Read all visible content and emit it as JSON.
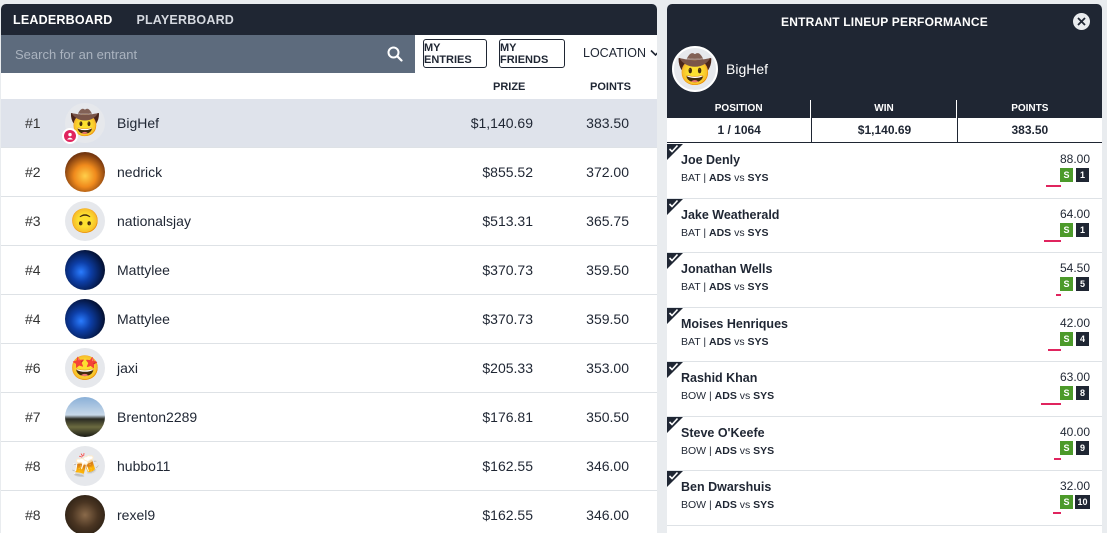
{
  "left": {
    "tabs": [
      "LEADERBOARD",
      "PLAYERBOARD"
    ],
    "search_placeholder": "Search for an entrant",
    "buttons": {
      "my_entries": "MY ENTRIES",
      "my_friends": "MY FRIENDS",
      "location": "LOCATION"
    },
    "columns": {
      "prize": "PRIZE",
      "points": "POINTS"
    },
    "rows": [
      {
        "rank": "#1",
        "name": "BigHef",
        "prize": "$1,140.69",
        "points": "383.50",
        "avatar": "cowboy-emoji",
        "highlight": true
      },
      {
        "rank": "#2",
        "name": "nedrick",
        "prize": "$855.52",
        "points": "372.00",
        "avatar": "fire-photo"
      },
      {
        "rank": "#3",
        "name": "nationalsjay",
        "prize": "$513.31",
        "points": "365.75",
        "avatar": "upside-down-emoji"
      },
      {
        "rank": "#4",
        "name": "Mattylee",
        "prize": "$370.73",
        "points": "359.50",
        "avatar": "blue-lights-photo"
      },
      {
        "rank": "#4",
        "name": "Mattylee",
        "prize": "$370.73",
        "points": "359.50",
        "avatar": "blue-lights-photo"
      },
      {
        "rank": "#6",
        "name": "jaxi",
        "prize": "$205.33",
        "points": "353.00",
        "avatar": "star-struck-emoji"
      },
      {
        "rank": "#7",
        "name": "Brenton2289",
        "prize": "$176.81",
        "points": "350.50",
        "avatar": "car-photo"
      },
      {
        "rank": "#8",
        "name": "hubbo11",
        "prize": "$162.55",
        "points": "346.00",
        "avatar": "beer-emoji"
      },
      {
        "rank": "#8",
        "name": "rexel9",
        "prize": "$162.55",
        "points": "346.00",
        "avatar": "dinosaur-photo"
      }
    ]
  },
  "right": {
    "title": "ENTRANT LINEUP PERFORMANCE",
    "user": "BigHef",
    "stats": [
      {
        "label": "POSITION",
        "value": "1 / 1064"
      },
      {
        "label": "WIN",
        "value": "$1,140.69"
      },
      {
        "label": "POINTS",
        "value": "383.50"
      }
    ],
    "players": [
      {
        "name": "Joe Denly",
        "pos": "BAT",
        "team": "ADS",
        "opp": "SYS",
        "points": "88.00",
        "s": "S",
        "num": "1",
        "bar": 0.75
      },
      {
        "name": "Jake Weatherald",
        "pos": "BAT",
        "team": "ADS",
        "opp": "SYS",
        "points": "64.00",
        "s": "S",
        "num": "1",
        "bar": 0.85
      },
      {
        "name": "Jonathan Wells",
        "pos": "BAT",
        "team": "ADS",
        "opp": "SYS",
        "points": "54.50",
        "s": "S",
        "num": "5",
        "bar": 0.25
      },
      {
        "name": "Moises Henriques",
        "pos": "BAT",
        "team": "ADS",
        "opp": "SYS",
        "points": "42.00",
        "s": "S",
        "num": "4",
        "bar": 0.65
      },
      {
        "name": "Rashid Khan",
        "pos": "BOW",
        "team": "ADS",
        "opp": "SYS",
        "points": "63.00",
        "s": "S",
        "num": "8",
        "bar": 1.0
      },
      {
        "name": "Steve O'Keefe",
        "pos": "BOW",
        "team": "ADS",
        "opp": "SYS",
        "points": "40.00",
        "s": "S",
        "num": "9",
        "bar": 0.35
      },
      {
        "name": "Ben Dwarshuis",
        "pos": "BOW",
        "team": "ADS",
        "opp": "SYS",
        "points": "32.00",
        "s": "S",
        "num": "10",
        "bar": 0.4
      }
    ]
  },
  "colors": {
    "dark": "#1f2633",
    "accent": "#e0245e",
    "green": "#4c9a2a",
    "highlight": "#dfe3eb"
  }
}
